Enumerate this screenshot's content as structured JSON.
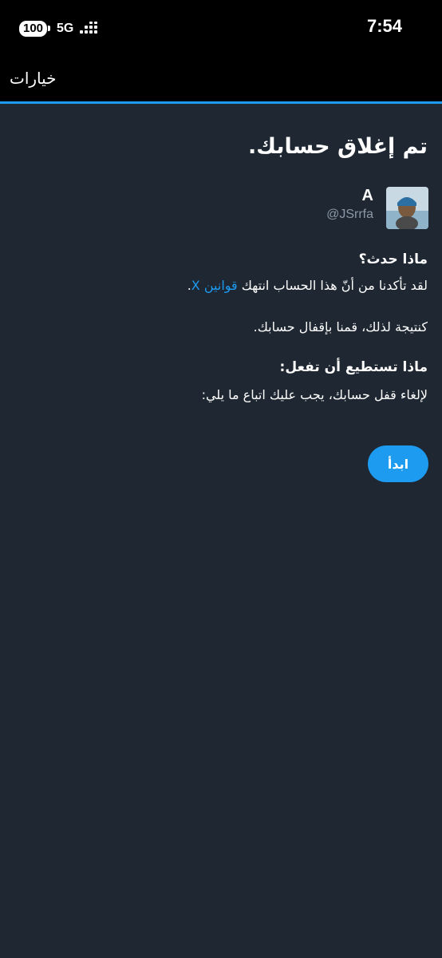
{
  "status_bar": {
    "battery": "100",
    "network": "5G",
    "time": "7:54"
  },
  "header": {
    "title": "خيارات"
  },
  "main": {
    "title": "تم إغلاق حسابك.",
    "account": {
      "name": "A",
      "handle": "@JSrrfa"
    },
    "what_happened_heading": "ماذا حدث؟",
    "what_happened_text": "لقد تأكدنا من أنّ هذا الحساب انتهك",
    "rules_link": "قوانين X",
    "period": ".",
    "consequence_text": "كنتيجة لذلك، قمنا بإقفال حسابك.",
    "what_to_do_heading": "ماذا تستطيع أن تفعل:",
    "what_to_do_text": "لإلغاء قفل حسابك، يجب عليك اتباع ما يلي:",
    "start_button": "ابدأ"
  },
  "colors": {
    "background": "#1e2732",
    "accent": "#1d9bf0",
    "secondary_text": "#8b98a5"
  }
}
